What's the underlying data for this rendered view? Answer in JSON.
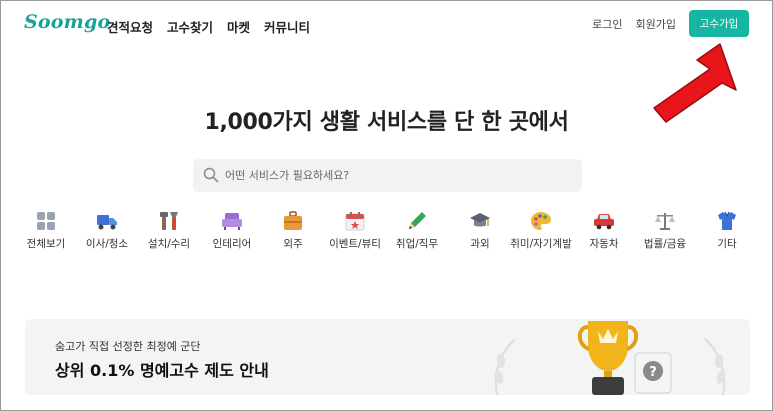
{
  "header": {
    "logo": "Soomgo",
    "nav": [
      "견적요청",
      "고수찾기",
      "마켓",
      "커뮤니티"
    ],
    "login": "로그인",
    "signup": "회원가입",
    "pro_signup": "고수가입"
  },
  "hero": {
    "title": "1,000가지 생활 서비스를 단 한 곳에서"
  },
  "search": {
    "placeholder": "어떤 서비스가 필요하세요?"
  },
  "categories": [
    {
      "label": "전체보기",
      "icon": "grid-icon"
    },
    {
      "label": "이사/청소",
      "icon": "truck-icon"
    },
    {
      "label": "설치/수리",
      "icon": "tools-icon"
    },
    {
      "label": "인테리어",
      "icon": "sofa-icon"
    },
    {
      "label": "외주",
      "icon": "briefcase-icon"
    },
    {
      "label": "이벤트/뷰티",
      "icon": "calendar-icon"
    },
    {
      "label": "취업/직무",
      "icon": "pencil-icon"
    },
    {
      "label": "과외",
      "icon": "graduation-cap-icon"
    },
    {
      "label": "취미/자기계발",
      "icon": "palette-icon"
    },
    {
      "label": "자동차",
      "icon": "car-icon"
    },
    {
      "label": "법률/금융",
      "icon": "scale-icon"
    },
    {
      "label": "기타",
      "icon": "shirt-icon"
    }
  ],
  "banner": {
    "subtitle": "숨고가 직접 선정한 최정예 군단",
    "title": "상위 0.1% 명예고수 제도 안내"
  },
  "colors": {
    "brand": "#16b5a4",
    "arrow": "#e8151b"
  }
}
